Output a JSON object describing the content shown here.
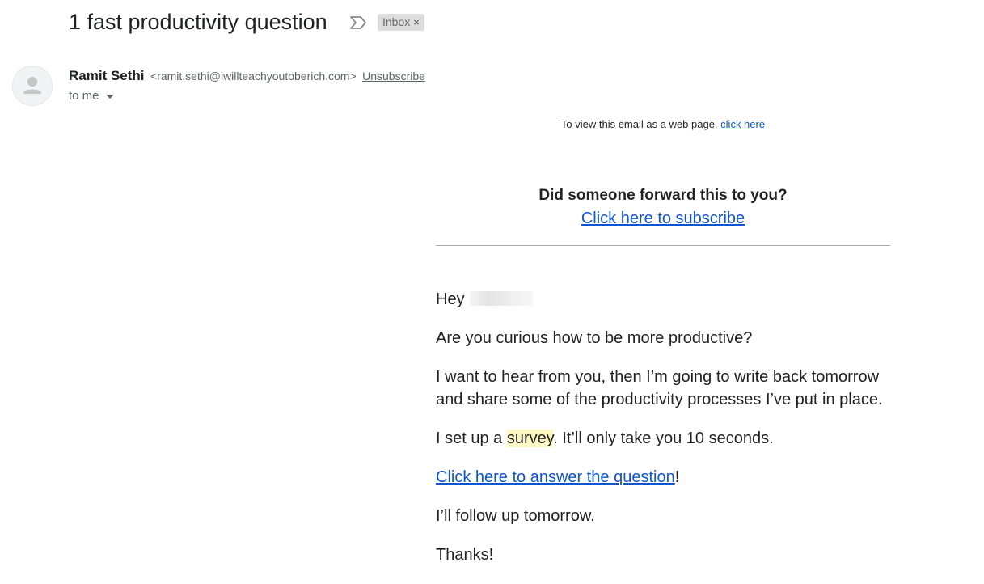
{
  "email": {
    "subject": "1 fast productivity question",
    "label": "Inbox",
    "label_remove": "×"
  },
  "sender": {
    "name": "Ramit Sethi",
    "email": "<ramit.sethi@iwillteachyoutoberich.com>",
    "unsubscribe": "Unsubscribe",
    "to": "to me"
  },
  "message": {
    "webview_text": "To view this email as a web page,",
    "webview_link": "click here",
    "forward_question": "Did someone forward this to you?",
    "subscribe_link": "Click here to subscribe",
    "greeting": "Hey",
    "p1": "Are you curious how to be more productive?",
    "p2": "I want to hear from you, then I’m going to write back tomorrow and share some of the productivity processes I’ve put in place.",
    "p3_before": "I set up a ",
    "p3_highlight": "survey",
    "p3_after": ". It’ll only take you 10 seconds.",
    "answer_link": "Click here to answer the question",
    "answer_suffix": "!",
    "p5": "I’ll follow up tomorrow.",
    "p6": "Thanks!"
  },
  "icons": {
    "importance": "importance-marker-icon",
    "avatar": "person-icon",
    "caret": "caret-down-icon"
  },
  "colors": {
    "link": "#1155cc",
    "highlight": "#fdf7c3",
    "chip": "#dddddd"
  }
}
